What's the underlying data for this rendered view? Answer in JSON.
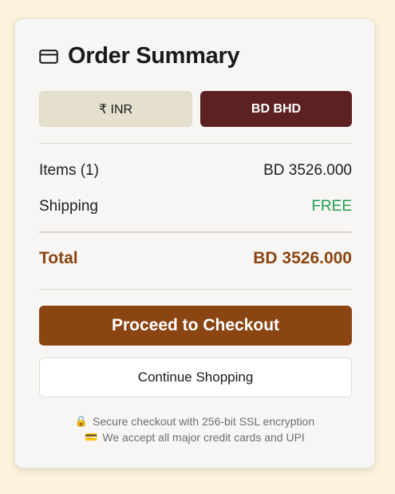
{
  "summary": {
    "title": "Order Summary",
    "icon": "credit-card-icon"
  },
  "currency": {
    "inr_label": "₹ INR",
    "bhd_label": "BD BHD",
    "selected": "BD BHD"
  },
  "lines": {
    "items_label": "Items (1)",
    "items_value": "BD 3526.000",
    "shipping_label": "Shipping",
    "shipping_value": "FREE",
    "total_label": "Total",
    "total_value": "BD 3526.000"
  },
  "actions": {
    "checkout_label": "Proceed to Checkout",
    "continue_label": "Continue Shopping"
  },
  "notes": {
    "secure_icon": "🔒",
    "secure_text": "Secure checkout with 256-bit SSL encryption",
    "cards_icon": "💳",
    "cards_text": "We accept all major credit cards and UPI"
  },
  "colors": {
    "page_bg": "#fcf3dc",
    "accent_brown": "#8b4513",
    "selected_currency": "#5c2121",
    "free_green": "#1f9e4e"
  }
}
